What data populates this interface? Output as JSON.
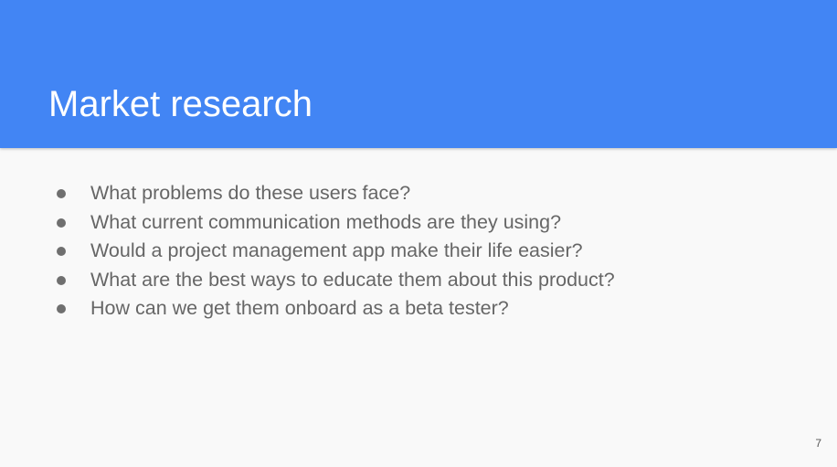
{
  "slide": {
    "title": "Market research",
    "bullets": [
      "What problems do these users face?",
      "What current communication methods are they using?",
      "Would a project management app make their life easier?",
      "What are the best ways to educate them about this product?",
      "How can we get them onboard as a beta tester?"
    ],
    "page_number": "7"
  },
  "colors": {
    "header_background": "#4285f4",
    "slide_background": "#f9f9f9",
    "title_text": "#ffffff",
    "body_text": "#666666"
  }
}
